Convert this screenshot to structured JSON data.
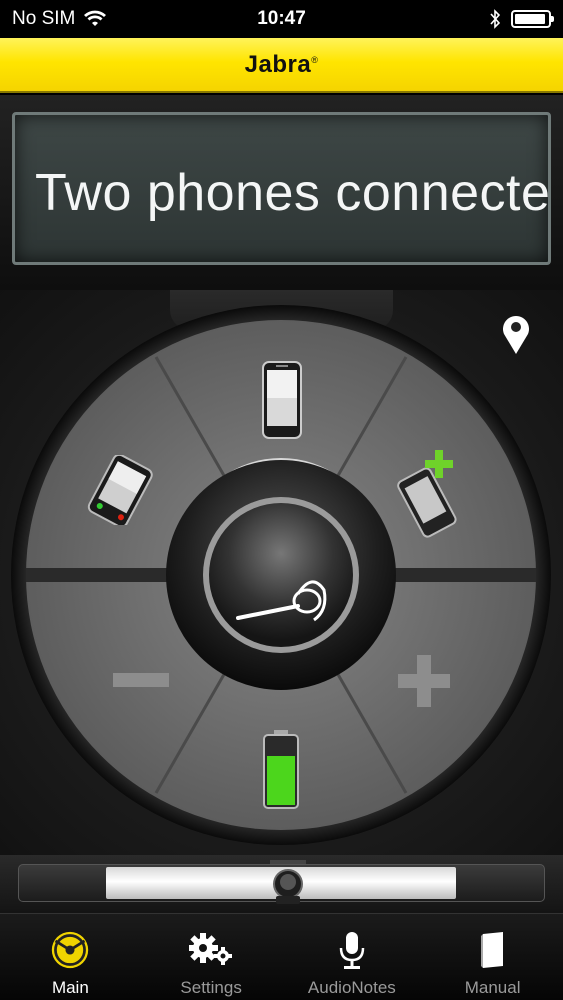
{
  "status_bar": {
    "carrier": "No SIM",
    "time": "10:47",
    "battery_level": 0.95
  },
  "header": {
    "brand": "Jabra",
    "brand_mark": "®",
    "accent_color": "#ffe500"
  },
  "display": {
    "message": "Two phones connected"
  },
  "controller": {
    "top_icon": "phone-icon",
    "left_icon": "second-phone-icon",
    "right_icon": "add-device-icon",
    "center_icon": "headset-icon",
    "bottom_icon": "battery-icon",
    "minus_icon": "volume-down-icon",
    "plus_icon": "volume-up-icon",
    "location_icon": "location-pin-icon",
    "battery_level": 0.7,
    "battery_color": "#4cd61c",
    "add_color": "#6fd22a"
  },
  "slider": {
    "value": 0.52
  },
  "tabs": [
    {
      "label": "Main",
      "icon": "main-radar-icon",
      "active": true
    },
    {
      "label": "Settings",
      "icon": "gears-icon",
      "active": false
    },
    {
      "label": "AudioNotes",
      "icon": "microphone-icon",
      "active": false
    },
    {
      "label": "Manual",
      "icon": "book-icon",
      "active": false
    }
  ]
}
